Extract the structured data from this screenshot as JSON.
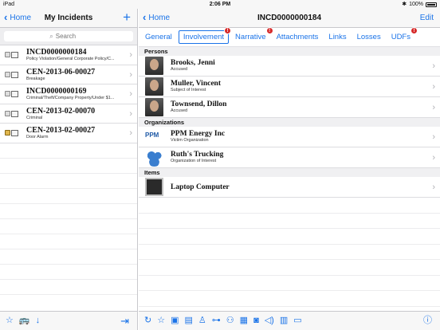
{
  "status": {
    "device": "iPad",
    "time": "2:06 PM",
    "battery": "100%"
  },
  "left": {
    "back_label": "Home",
    "title": "My Incidents",
    "add_label": "+",
    "search_placeholder": "Search",
    "incidents": [
      {
        "title": "INCD0000000184",
        "sub": "Policy Violation/General Corporate Policy/C..."
      },
      {
        "title": "CEN-2013-06-00027",
        "sub": "Breakage"
      },
      {
        "title": "INCD0000000169",
        "sub": "Criminal/Theft/Company Property/Under $1..."
      },
      {
        "title": "CEN-2013-02-00070",
        "sub": "Criminal"
      },
      {
        "title": "CEN-2013-02-00027",
        "sub": "Door Alarm"
      }
    ],
    "toolbar": {
      "star_icon": "star-icon",
      "vehicle_icon": "vehicle-icon",
      "download_icon": "arrow-down-icon",
      "logout_icon": "logout-icon"
    }
  },
  "right": {
    "back_label": "Home",
    "title": "INCD0000000184",
    "edit_label": "Edit",
    "tabs": [
      {
        "label": "General",
        "badge": ""
      },
      {
        "label": "Involvement",
        "badge": "!"
      },
      {
        "label": "Narrative",
        "badge": "!"
      },
      {
        "label": "Attachments",
        "badge": ""
      },
      {
        "label": "Links",
        "badge": ""
      },
      {
        "label": "Losses",
        "badge": ""
      },
      {
        "label": "UDFs",
        "badge": "!"
      }
    ],
    "sections": {
      "persons": "Persons",
      "organizations": "Organizations",
      "items": "Items"
    },
    "persons": [
      {
        "name": "Brooks, Jenni",
        "role": "Accused"
      },
      {
        "name": "Muller, Vincent",
        "role": "Subject of Interest"
      },
      {
        "name": "Townsend, Dillon",
        "role": "Accused"
      }
    ],
    "organizations": [
      {
        "name": "PPM Energy Inc",
        "role": "Victim Organization",
        "logo": "PPM"
      },
      {
        "name": "Ruth's Trucking",
        "role": "Organization of Interest"
      }
    ],
    "items": [
      {
        "name": "Laptop Computer"
      }
    ]
  }
}
